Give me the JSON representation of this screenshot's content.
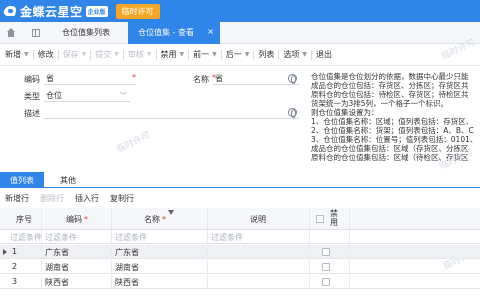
{
  "header": {
    "brand": "金蝶云星空",
    "edition": "企业版",
    "license": "临时许可"
  },
  "tabs": {
    "list_tab": "仓位值集列表",
    "active_tab": "仓位值集 - 查看",
    "close": "×"
  },
  "toolbar": [
    {
      "label": "新增",
      "dropdown": true,
      "disabled": false
    },
    {
      "label": "修改",
      "dropdown": false,
      "disabled": false
    },
    {
      "label": "保存",
      "dropdown": true,
      "disabled": true
    },
    {
      "label": "提交",
      "dropdown": true,
      "disabled": true
    },
    {
      "label": "审核",
      "dropdown": true,
      "disabled": true
    },
    {
      "label": "禁用",
      "dropdown": true,
      "disabled": false
    },
    {
      "label": "前一",
      "dropdown": true,
      "disabled": false
    },
    {
      "label": "后一",
      "dropdown": true,
      "disabled": false
    },
    {
      "label": "列表",
      "dropdown": false,
      "disabled": false
    },
    {
      "label": "选项",
      "dropdown": true,
      "disabled": false
    },
    {
      "label": "退出",
      "dropdown": false,
      "disabled": false
    }
  ],
  "form": {
    "code_label": "编码",
    "code_value": "省",
    "name_label": "名称",
    "name_value": "省",
    "type_label": "类型",
    "type_value": "仓位",
    "desc_label": "描述",
    "desc_value": "",
    "required_mark": "*"
  },
  "description_lines": [
    "仓位值集是仓位划分的依据，数据中心最少只能",
    "成品仓的仓位包括：存货区、分拣区；存货区共",
    "原料仓的仓位包括：待检区、存货区；待检区共",
    "货架统一为3排5列，一个格子一个标识。",
    "则仓位值集设置为：",
    "1、仓位值集名称：区域；值列表包括：存货区、",
    "2、仓位值集名称：货架；值列表包括：A、B、C",
    "3、仓位值集名称：位置号；值列表包括：0101、",
    "成品仓的仓位值集包括：区域（存货区、分拣区",
    "原料仓的仓位值集包括：区域（待检区、存货区"
  ],
  "watermark": "临时许可",
  "entry_tabs": {
    "values": "值列表",
    "other": "其他"
  },
  "entry_toolbar": {
    "add_row": "新增行",
    "delete_row": "删除行",
    "insert_row": "插入行",
    "copy_row": "复制行"
  },
  "grid": {
    "columns": {
      "seq": "序号",
      "code": "编码",
      "name": "名称",
      "note": "说明",
      "disabled_line1": "禁",
      "disabled_line2": "用",
      "required_mark": "*"
    },
    "filter_placeholder": "过滤条件",
    "rows": [
      {
        "seq": "1",
        "code": "广东省",
        "name": "广东省",
        "note": "",
        "disabled": false
      },
      {
        "seq": "2",
        "code": "湖南省",
        "name": "湖南省",
        "note": "",
        "disabled": false
      },
      {
        "seq": "3",
        "code": "陕西省",
        "name": "陕西省",
        "note": "",
        "disabled": false
      }
    ]
  },
  "colors": {
    "accent": "#2f86e8",
    "license_badge": "#f5a623",
    "required": "#e03c31"
  }
}
